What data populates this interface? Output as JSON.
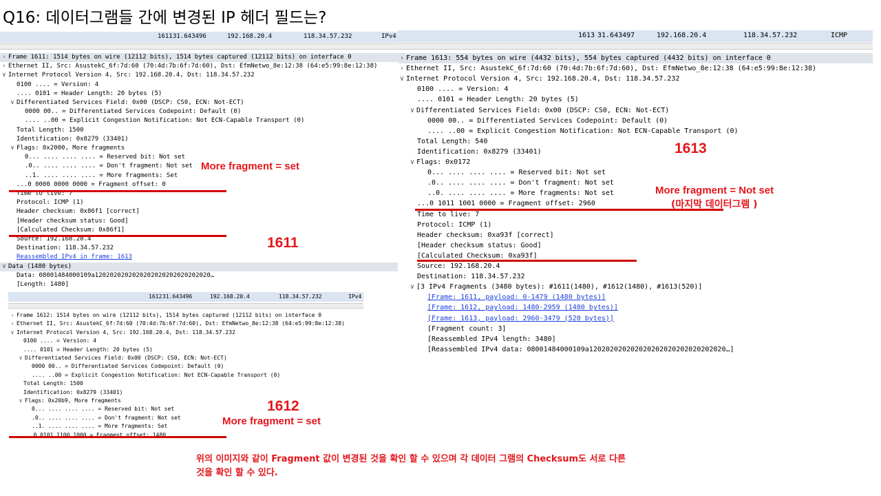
{
  "title": "Q16: 데이터그램들 간에 변경된 IP 헤더 필드는?",
  "p1611": {
    "summary": {
      "no": "1611",
      "time": "31.643496",
      "src": "192.168.20.4",
      "dst": "118.34.57.232",
      "proto": "IPv4"
    },
    "rows": [
      {
        "t": ">",
        "x": 0,
        "text": "Frame 1611: 1514 bytes on wire (12112 bits), 1514 bytes captured (12112 bits) on interface 0",
        "hl": true
      },
      {
        "t": ">",
        "x": 0,
        "text": "Ethernet II, Src: AsustekC_6f:7d:60 (70:4d:7b:6f:7d:60), Dst: EfmNetwo_8e:12:38 (64:e5:99:8e:12:38)"
      },
      {
        "t": "v",
        "x": 0,
        "text": "Internet Protocol Version 4, Src: 192.168.20.4, Dst: 118.34.57.232"
      },
      {
        "t": "",
        "x": 1,
        "text": "0100 .... = Version: 4"
      },
      {
        "t": "",
        "x": 1,
        "text": ".... 0101 = Header Length: 20 bytes (5)"
      },
      {
        "t": "v",
        "x": 0,
        "text": "Differentiated Services Field: 0x00 (DSCP: CS0, ECN: Not-ECT)",
        "ind": 1
      },
      {
        "t": "",
        "x": 2,
        "text": "0000 00.. = Differentiated Services Codepoint: Default (0)"
      },
      {
        "t": "",
        "x": 2,
        "text": ".... ..00 = Explicit Congestion Notification: Not ECN-Capable Transport (0)"
      },
      {
        "t": "",
        "x": 1,
        "text": "Total Length: 1500"
      },
      {
        "t": "",
        "x": 1,
        "text": "Identification: 0x8279 (33401)"
      },
      {
        "t": "v",
        "x": 0,
        "text": "Flags: 0x2000, More fragments",
        "ind": 1
      },
      {
        "t": "",
        "x": 2,
        "text": "0... .... .... .... = Reserved bit: Not set"
      },
      {
        "t": "",
        "x": 2,
        "text": ".0.. .... .... .... = Don't fragment: Not set"
      },
      {
        "t": "",
        "x": 2,
        "text": "..1. .... .... .... = More fragments: Set"
      },
      {
        "t": "",
        "x": 1,
        "text": "...0 0000 0000 0000 = Fragment offset: 0"
      },
      {
        "t": "",
        "x": 1,
        "text": "Time to live: 7"
      },
      {
        "t": "",
        "x": 1,
        "text": "Protocol: ICMP (1)"
      },
      {
        "t": "",
        "x": 1,
        "text": "Header checksum: 0x86f1 [correct]"
      },
      {
        "t": "",
        "x": 1,
        "text": "[Header checksum status: Good]"
      },
      {
        "t": "",
        "x": 1,
        "text": "[Calculated Checksum: 0x86f1]"
      },
      {
        "t": "",
        "x": 1,
        "text": "Source: 192.168.20.4"
      },
      {
        "t": "",
        "x": 1,
        "text": "Destination: 118.34.57.232"
      },
      {
        "t": "",
        "x": 1,
        "text": "Reassembled IPv4 in frame: 1613",
        "link": true
      },
      {
        "t": "v",
        "x": 0,
        "text": "Data (1480 bytes)",
        "hl": true
      },
      {
        "t": "",
        "x": 1,
        "text": "Data: 08001484000109a1202020202020202020202020202020…"
      },
      {
        "t": "",
        "x": 1,
        "text": "[Length: 1480]"
      }
    ]
  },
  "p1612": {
    "summary": {
      "no": "1612",
      "time": "31.643496",
      "src": "192.168.20.4",
      "dst": "118.34.57.232",
      "proto": "IPv4"
    },
    "rows": [
      {
        "t": ">",
        "x": 0,
        "text": "Frame 1612: 1514 bytes on wire (12112 bits), 1514 bytes captured (12112 bits) on interface 0"
      },
      {
        "t": ">",
        "x": 0,
        "text": "Ethernet II, Src: AsustekC_6f:7d:60 (70:4d:7b:6f:7d:60), Dst: EfmNetwo_8e:12:38 (64:e5:99:8e:12:38)"
      },
      {
        "t": "v",
        "x": 0,
        "text": "Internet Protocol Version 4, Src: 192.168.20.4, Dst: 118.34.57.232"
      },
      {
        "t": "",
        "x": 1,
        "text": "0100 .... = Version: 4"
      },
      {
        "t": "",
        "x": 1,
        "text": ".... 0101 = Header Length: 20 bytes (5)"
      },
      {
        "t": "v",
        "x": 0,
        "text": "Differentiated Services Field: 0x00 (DSCP: CS0, ECN: Not-ECT)",
        "ind": 1
      },
      {
        "t": "",
        "x": 2,
        "text": "0000 00.. = Differentiated Services Codepoint: Default (0)"
      },
      {
        "t": "",
        "x": 2,
        "text": ".... ..00 = Explicit Congestion Notification: Not ECN-Capable Transport (0)"
      },
      {
        "t": "",
        "x": 1,
        "text": "Total Length: 1500"
      },
      {
        "t": "",
        "x": 1,
        "text": "Identification: 0x8279 (33401)"
      },
      {
        "t": "v",
        "x": 0,
        "text": "Flags: 0x20b9, More fragments",
        "ind": 1
      },
      {
        "t": "",
        "x": 2,
        "text": "0... .... .... .... = Reserved bit: Not set"
      },
      {
        "t": "",
        "x": 2,
        "text": ".0.. .... .... .... = Don't fragment: Not set"
      },
      {
        "t": "",
        "x": 2,
        "text": "..1. .... .... .... = More fragments: Set"
      },
      {
        "t": "",
        "x": 1,
        "text": "...0 0101 1100 1000 = Fragment offset: 1480"
      }
    ]
  },
  "p1613": {
    "summary": {
      "no": "1613",
      "time": "31.643497",
      "src": "192.168.20.4",
      "dst": "118.34.57.232",
      "proto": "ICMP"
    },
    "rows": [
      {
        "t": ">",
        "x": 0,
        "text": "Frame 1613: 554 bytes on wire (4432 bits), 554 bytes captured (4432 bits) on interface 0",
        "hl": true
      },
      {
        "t": ">",
        "x": 0,
        "text": "Ethernet II, Src: AsustekC_6f:7d:60 (70:4d:7b:6f:7d:60), Dst: EfmNetwo_8e:12:38 (64:e5:99:8e:12:38)"
      },
      {
        "t": "v",
        "x": 0,
        "text": "Internet Protocol Version 4, Src: 192.168.20.4, Dst: 118.34.57.232"
      },
      {
        "t": "",
        "x": 1,
        "text": "0100 .... = Version: 4"
      },
      {
        "t": "",
        "x": 1,
        "text": ".... 0101 = Header Length: 20 bytes (5)"
      },
      {
        "t": "v",
        "x": 0,
        "text": "Differentiated Services Field: 0x00 (DSCP: CS0, ECN: Not-ECT)",
        "ind": 1
      },
      {
        "t": "",
        "x": 2,
        "text": "0000 00.. = Differentiated Services Codepoint: Default (0)"
      },
      {
        "t": "",
        "x": 2,
        "text": ".... ..00 = Explicit Congestion Notification: Not ECN-Capable Transport (0)"
      },
      {
        "t": "",
        "x": 1,
        "text": "Total Length: 540"
      },
      {
        "t": "",
        "x": 1,
        "text": "Identification: 0x8279 (33401)"
      },
      {
        "t": "v",
        "x": 0,
        "text": "Flags: 0x0172",
        "ind": 1
      },
      {
        "t": "",
        "x": 2,
        "text": "0... .... .... .... = Reserved bit: Not set"
      },
      {
        "t": "",
        "x": 2,
        "text": ".0.. .... .... .... = Don't fragment: Not set"
      },
      {
        "t": "",
        "x": 2,
        "text": "..0. .... .... .... = More fragments: Not set"
      },
      {
        "t": "",
        "x": 1,
        "text": "...0 1011 1001 0000 = Fragment offset: 2960"
      },
      {
        "t": "",
        "x": 1,
        "text": "Time to live: 7"
      },
      {
        "t": "",
        "x": 1,
        "text": "Protocol: ICMP (1)"
      },
      {
        "t": "",
        "x": 1,
        "text": "Header checksum: 0xa93f [correct]"
      },
      {
        "t": "",
        "x": 1,
        "text": "[Header checksum status: Good]"
      },
      {
        "t": "",
        "x": 1,
        "text": "[Calculated Checksum: 0xa93f]"
      },
      {
        "t": "",
        "x": 1,
        "text": "Source: 192.168.20.4"
      },
      {
        "t": "",
        "x": 1,
        "text": "Destination: 118.34.57.232"
      },
      {
        "t": "v",
        "x": 0,
        "text": "[3 IPv4 Fragments (3480 bytes): #1611(1480), #1612(1480), #1613(520)]",
        "ind": 1
      },
      {
        "t": "",
        "x": 2,
        "text": "[Frame: 1611, payload: 0-1479 (1480 bytes)]",
        "link": true
      },
      {
        "t": "",
        "x": 2,
        "text": "[Frame: 1612, payload: 1480-2959 (1480 bytes)]",
        "link": true
      },
      {
        "t": "",
        "x": 2,
        "text": "[Frame: 1613, payload: 2960-3479 (520 bytes)]",
        "link": true
      },
      {
        "t": "",
        "x": 2,
        "text": "[Fragment count: 3]"
      },
      {
        "t": "",
        "x": 2,
        "text": "[Reassembled IPv4 length: 3480]"
      },
      {
        "t": "",
        "x": 2,
        "text": "[Reassembled IPv4 data: 08001484000109a120202020202020202020202020202020…]"
      }
    ]
  },
  "annotations": {
    "mf_set_1611": "More fragment = set",
    "label_1611": "1611",
    "label_1612": "1612",
    "mf_set_1612": "More fragment = set",
    "label_1613": "1613",
    "mf_notset_1613": "More fragment = Not set",
    "last_datagram": "(마지막 데이터그램 )",
    "note_line1": "위의 이미지와 같이 Fragment 값이 변경된 것을 확인 할 수 있으며 각 데이터 그램의 Checksum도 서로 다른",
    "note_line2": "것을 확인 할 수 있다."
  },
  "colors": {
    "annotation": "#e3161c",
    "underline": "#d40000",
    "summary_bg": "#dbe4f1",
    "link": "#1a3ee0"
  }
}
